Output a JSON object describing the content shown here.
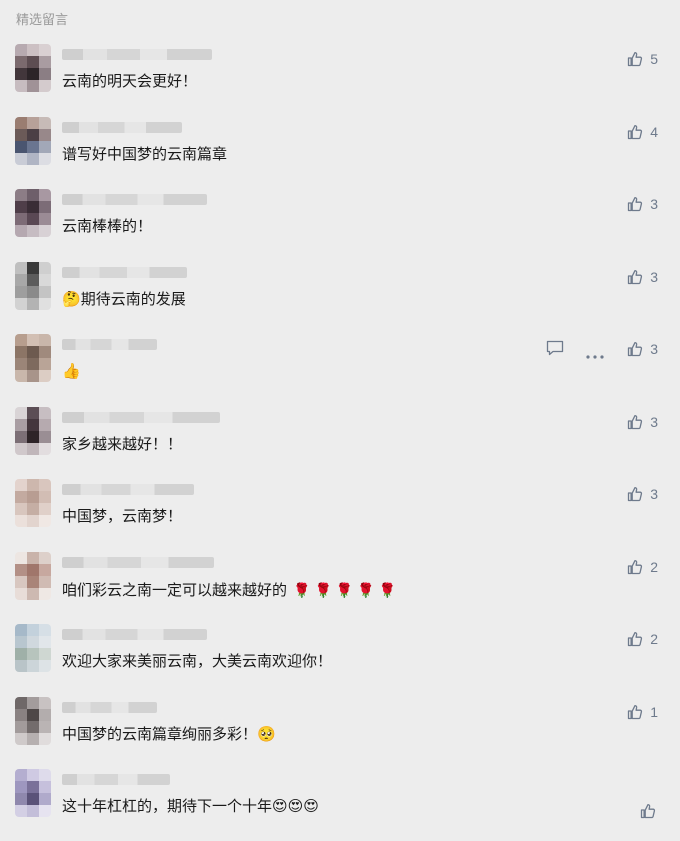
{
  "section": {
    "title": "精选留言"
  },
  "comments": [
    {
      "text": "云南的明天会更好！",
      "likes": "5",
      "name_width": 150,
      "avatar": [
        "#b7aab0",
        "#ccc0c3",
        "#d9d0d2",
        "#7b6a6e",
        "#5d4d52",
        "#a99ca1",
        "#42363b",
        "#2c2428",
        "#8b7e84",
        "#c7bcc0",
        "#a09297",
        "#d4cbcd"
      ]
    },
    {
      "text": "谱写好中国梦的云南篇章",
      "likes": "4",
      "name_width": 120,
      "avatar": [
        "#9a7d71",
        "#b7a199",
        "#c7bbb7",
        "#6b5a58",
        "#4b3f45",
        "#98888a",
        "#4a5570",
        "#6a7590",
        "#a2a8b8",
        "#c9ccd6",
        "#b0b5c4",
        "#dcdde3"
      ]
    },
    {
      "text": "云南棒棒的！",
      "likes": "3",
      "name_width": 145,
      "avatar": [
        "#8c7d86",
        "#6e5f6a",
        "#a898a2",
        "#4f3e49",
        "#3a2d36",
        "#7c6c77",
        "#7d6b76",
        "#5a4854",
        "#9b8b95",
        "#b5a8b0",
        "#c6bcc2",
        "#d8d1d5"
      ]
    },
    {
      "text": "期待云南的发展",
      "likes": "3",
      "name_width": 125,
      "emoji_prefix": "🤔",
      "avatar": [
        "#bfbfbf",
        "#3a3a3a",
        "#cfcfcf",
        "#a8a8a8",
        "#5c5c5c",
        "#d9d9d9",
        "#9e9e9e",
        "#8a8a8a",
        "#c4c4c4",
        "#d2d2d2",
        "#b3b3b3",
        "#e0e0e0"
      ]
    },
    {
      "text": "",
      "likes": "3",
      "name_width": 95,
      "emoji_only": "👍",
      "show_tools": true,
      "avatar": [
        "#b79e8e",
        "#d2bfb3",
        "#c9b6aa",
        "#8c7566",
        "#6d5a4f",
        "#a08a7d",
        "#9b8578",
        "#7e6a5e",
        "#b9a497",
        "#c9b7ab",
        "#a8948a",
        "#dccdc4"
      ]
    },
    {
      "text": "家乡越来越好！！",
      "likes": "3",
      "name_width": 158,
      "avatar": [
        "#d9d4d6",
        "#5c4e55",
        "#c7bec2",
        "#a99ea3",
        "#44363d",
        "#b6aaaf",
        "#7c6f76",
        "#2e2428",
        "#9a8e94",
        "#d0c8cb",
        "#c0b6ba",
        "#e2dddf"
      ]
    },
    {
      "text": "中国梦，云南梦！",
      "likes": "3",
      "name_width": 132,
      "avatar": [
        "#e3d3cd",
        "#cdb7ad",
        "#d9c6be",
        "#c3aaa0",
        "#b89d92",
        "#d2bdb4",
        "#d8c6be",
        "#c5aea4",
        "#e0d0c9",
        "#ebe0db",
        "#e2d4ce",
        "#f0e8e4"
      ]
    },
    {
      "text": "咱们彩云之南一定可以越来越好的",
      "likes": "2",
      "name_width": 152,
      "flowers": 5,
      "avatar": [
        "#ede6e2",
        "#c9b3aa",
        "#ddd0ca",
        "#b39086",
        "#a0766b",
        "#c7a89f",
        "#d8c7c0",
        "#a98478",
        "#d0bbb3",
        "#e8ddd8",
        "#cdb9b1",
        "#efe8e4"
      ]
    },
    {
      "text": "欢迎大家来美丽云南，大美云南欢迎你！",
      "likes": "2",
      "name_width": 145,
      "avatar": [
        "#a6b9c9",
        "#c3d1dc",
        "#d6dfe6",
        "#b8c6cf",
        "#d0d8de",
        "#e1e6ea",
        "#9fb0a8",
        "#b7c4bd",
        "#cfd7d2",
        "#b9c4c8",
        "#ccd5d9",
        "#dde3e6"
      ]
    },
    {
      "text": "中国梦的云南篇章绚丽多彩！",
      "likes": "1",
      "name_width": 95,
      "emoji_suffix": "🥺",
      "avatar": [
        "#6f6868",
        "#a39c9c",
        "#c8c2c2",
        "#8a8282",
        "#4e4747",
        "#b3adad",
        "#a29b9b",
        "#736c6c",
        "#bab4b4",
        "#cfcaca",
        "#b6b0b0",
        "#e0dcdc"
      ]
    },
    {
      "text": "这十年杠杠的，期待下一个十年",
      "likes": "",
      "name_width": 108,
      "emoji_suffix": "😍😍😍",
      "avatar": [
        "#b4aed0",
        "#cfcae3",
        "#dedbeb",
        "#9e97bf",
        "#7a7199",
        "#c6c0dc",
        "#8f88ad",
        "#5a5278",
        "#b0aacb",
        "#d3cfe4",
        "#c3bed9",
        "#e6e3f0"
      ]
    }
  ],
  "tools": {
    "reply_icon": "comment-icon",
    "more_icon": "more-icon",
    "like_icon": "thumbs-up-icon"
  },
  "colors": {
    "background": "#ededed",
    "icon": "#6e7a8c",
    "section_title": "#9a9a9a"
  }
}
